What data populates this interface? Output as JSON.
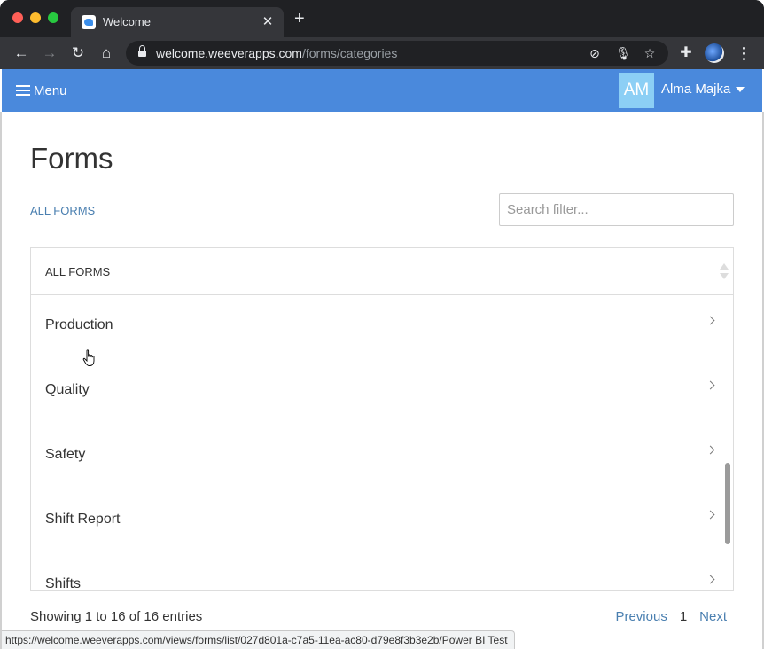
{
  "browser": {
    "tab_title": "Welcome",
    "tab_close": "✕",
    "new_tab": "+",
    "url_host": "welcome.weeverapps.com",
    "url_path": "/forms/categories",
    "status_url": "https://welcome.weeverapps.com/views/forms/list/027d801a-c7a5-11ea-ac80-d79e8f3b3e2b/Power BI Test",
    "back_icon": "←",
    "forward_icon": "→",
    "reload_icon": "↻",
    "home_icon": "⌂",
    "star_icon": "☆",
    "mic_icon": "🎙",
    "camera_icon": "⊘",
    "extensions_icon": "✚",
    "menu_icon": "⋮"
  },
  "header": {
    "menu_label": "Menu",
    "avatar_initials": "AM",
    "user_name": "Alma Majka",
    "brand_color": "#4a89dc"
  },
  "main": {
    "title": "Forms",
    "breadcrumb": "ALL FORMS",
    "search_placeholder": "Search filter..."
  },
  "table": {
    "column_header": "ALL FORMS",
    "rows": [
      {
        "label": "Production"
      },
      {
        "label": "Quality"
      },
      {
        "label": "Safety"
      },
      {
        "label": "Shift Report"
      },
      {
        "label": "Shifts"
      }
    ]
  },
  "footer": {
    "entries_info": "Showing 1 to 16 of 16 entries",
    "previous_label": "Previous",
    "current_page": "1",
    "next_label": "Next"
  }
}
